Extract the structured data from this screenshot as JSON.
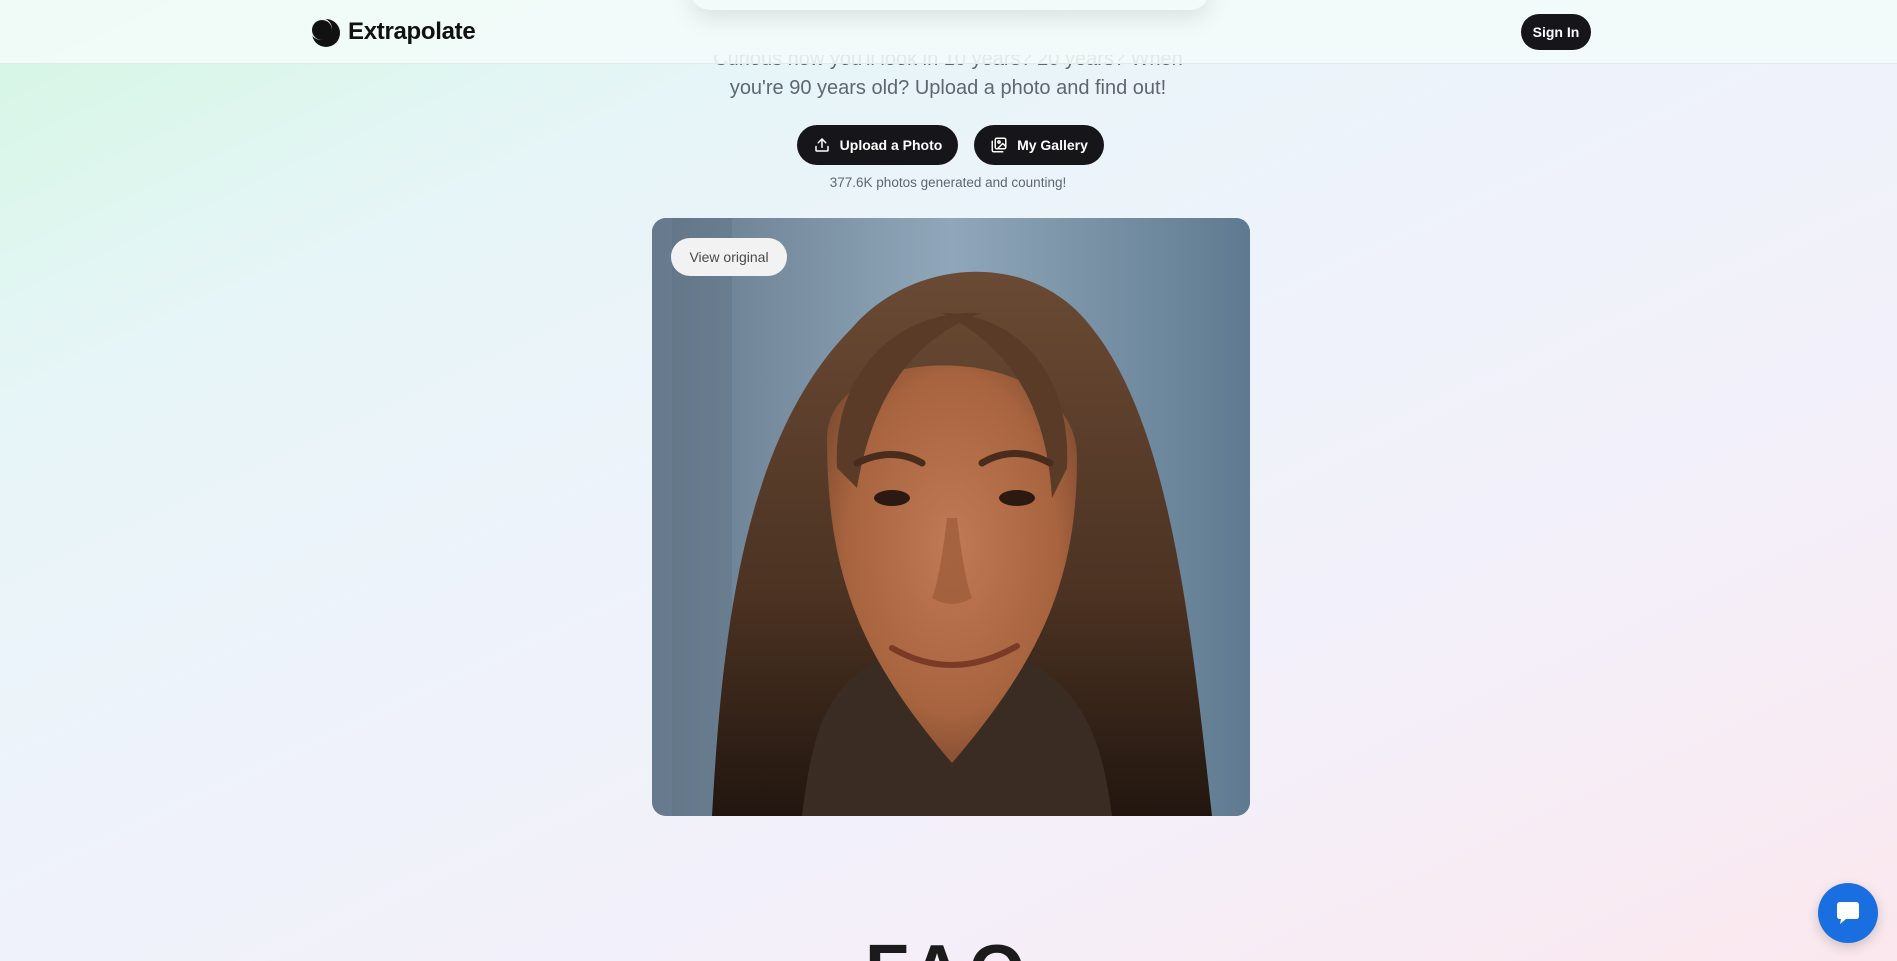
{
  "header": {
    "brand": "Extrapolate",
    "logo_icon": "crescent-logo-icon",
    "signin_label": "Sign In"
  },
  "hero": {
    "subtitle_line1": "Curious how you'll look in 10 years? 20 years? When",
    "subtitle_line2": "you're 90 years old? Upload a photo and find out!",
    "upload_label": "Upload a Photo",
    "upload_icon": "upload-icon",
    "gallery_label": "My Gallery",
    "gallery_icon": "gallery-icon",
    "counter": "377.6K photos generated and counting!"
  },
  "preview": {
    "view_original_label": "View original"
  },
  "faq": {
    "title": "FAQ"
  },
  "chat": {
    "icon": "chat-bubble-icon"
  },
  "colors": {
    "primary_button": "#16161a",
    "chat_button": "#1a6fe0",
    "text_muted": "#5f6670"
  }
}
